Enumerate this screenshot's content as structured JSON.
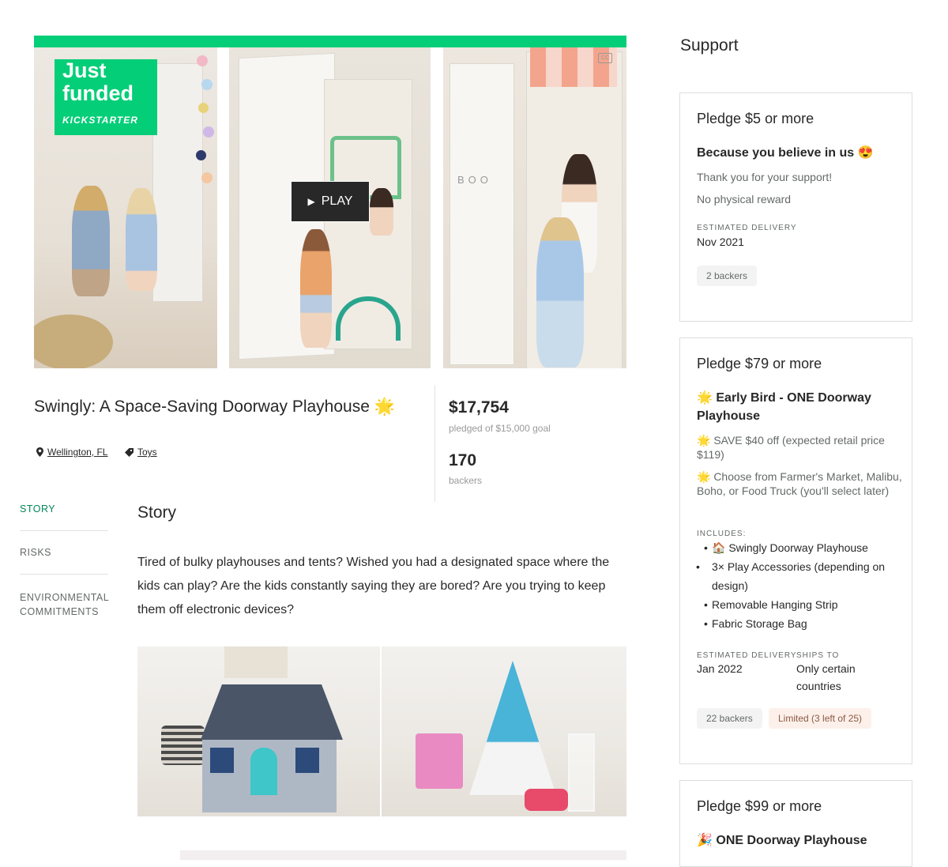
{
  "video": {
    "badge_line1": "Just",
    "badge_line2": "funded",
    "badge_brand": "KICKSTARTER",
    "play_label": "PLAY",
    "cc_label": "CC",
    "wall_sign": "BOO",
    "accent": "#05ce78"
  },
  "project": {
    "title": "Swingly: A Space-Saving Doorway Playhouse",
    "title_emoji": "🌟",
    "location": "Wellington, FL",
    "category": "Toys"
  },
  "stats": {
    "pledged": "$17,754",
    "goal": "pledged of $15,000 goal",
    "backers_count": "170",
    "backers_label": "backers"
  },
  "nav": {
    "items": [
      {
        "label": "STORY",
        "active": true
      },
      {
        "label": "RISKS",
        "active": false
      },
      {
        "label": "ENVIRONMENTAL COMMITMENTS",
        "active": false
      }
    ]
  },
  "story": {
    "heading": "Story",
    "paragraph": "Tired of bulky playhouses and tents? Wished you had a designated space where the kids can play? Are the kids constantly saying they are bored? Are you trying to keep them off electronic devices?"
  },
  "support": {
    "heading": "Support",
    "rewards": [
      {
        "title": "Pledge $5 or more",
        "name": "Because you believe in us 😍",
        "desc1": "Thank you for your support!",
        "desc2": "No physical reward",
        "delivery_label": "ESTIMATED DELIVERY",
        "delivery": "Nov 2021",
        "backers": "2 backers"
      },
      {
        "title": "Pledge $79 or more",
        "name": "🌟 Early Bird - ONE Doorway Playhouse",
        "desc1": "🌟 SAVE $40 off (expected retail price $119)",
        "desc2": "🌟 Choose from Farmer's Market, Malibu, Boho, or Food Truck (you'll select later)",
        "includes_label": "INCLUDES:",
        "includes": [
          "🏠 Swingly Doorway Playhouse",
          "3× Play Accessories (depending on design)",
          "Removable Hanging Strip",
          "Fabric Storage Bag"
        ],
        "delivery_label": "ESTIMATED DELIVERY",
        "delivery": "Jan 2022",
        "ships_label": "SHIPS TO",
        "ships": "Only certain countries",
        "backers": "22 backers",
        "limited": "Limited (3 left of 25)"
      },
      {
        "title": "Pledge $99 or more",
        "name": "🎉 ONE Doorway Playhouse"
      }
    ]
  },
  "colors": {
    "accent_green": "#05ce78",
    "active_nav": "#028858",
    "text": "#282828",
    "muted": "#656969"
  }
}
